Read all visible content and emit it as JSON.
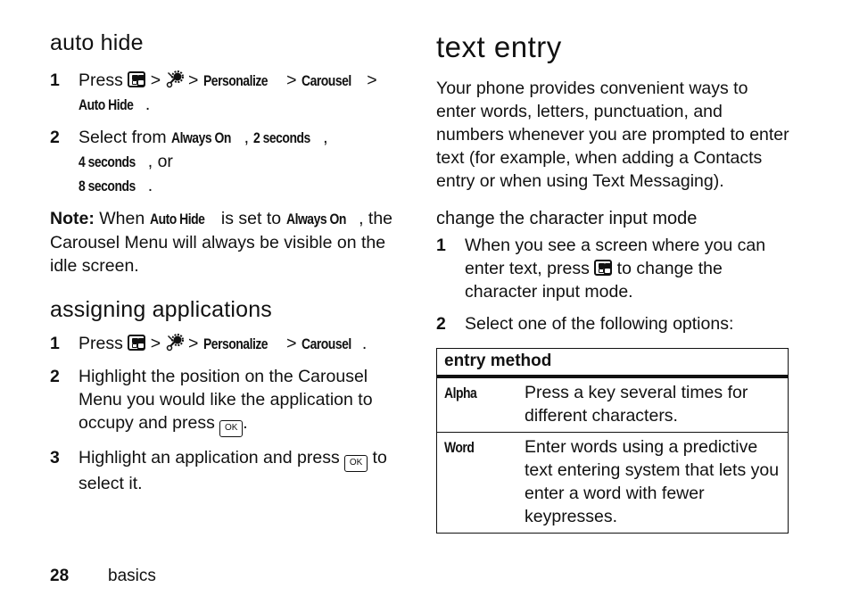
{
  "left_column": {
    "auto_hide": {
      "heading": "auto hide",
      "steps": [
        {
          "num": "1",
          "press": "Press",
          "sep": ">",
          "path_1": "Personalize",
          "path_2": "Carousel",
          "path_3": "Auto Hide",
          "end": "."
        },
        {
          "num": "2",
          "prefix": "Select from",
          "opt_1": "Always On",
          "opt_2": "2 seconds",
          "opt_3": "4 seconds",
          "or": ", or",
          "opt_4": "8 seconds",
          "end": "."
        }
      ],
      "note": {
        "label": "Note:",
        "text_1": "When",
        "term_1": "Auto Hide",
        "text_2": "is set to",
        "term_2": "Always On",
        "text_3": ", the Carousel Menu will always be visible on the idle screen."
      }
    },
    "assigning": {
      "heading": "assigning applications",
      "steps": [
        {
          "num": "1",
          "press": "Press",
          "sep": ">",
          "path_1": "Personalize",
          "path_2": "Carousel",
          "end": "."
        },
        {
          "num": "2",
          "text": "Highlight the position on the Carousel Menu you would like the application to occupy and press",
          "end": "."
        },
        {
          "num": "3",
          "text": "Highlight an application and press",
          "end": "to select it."
        }
      ]
    }
  },
  "right_column": {
    "title": "text entry",
    "intro": "Your phone provides convenient ways to enter words, letters, punctuation, and numbers whenever you are prompted to enter text (for example, when adding a Contacts entry or when using Text Messaging).",
    "subheading": "change the character input mode",
    "steps": [
      {
        "num": "1",
        "text_1": "When you see a screen where you can enter text, press",
        "text_2": "to change the character input mode."
      },
      {
        "num": "2",
        "text": "Select one of the following options:"
      }
    ],
    "table": {
      "header": "entry method",
      "rows": [
        {
          "key": "Alpha",
          "desc": "Press a key several times for different characters."
        },
        {
          "key": "Word",
          "desc": "Enter words using a predictive text entering system that lets you enter a word with fewer keypresses."
        }
      ]
    }
  },
  "icons": {
    "menu_key": "menu-key-icon",
    "settings": "settings-icon",
    "ok_key_label": "OK"
  },
  "footer": {
    "page_number": "28",
    "section": "basics"
  }
}
